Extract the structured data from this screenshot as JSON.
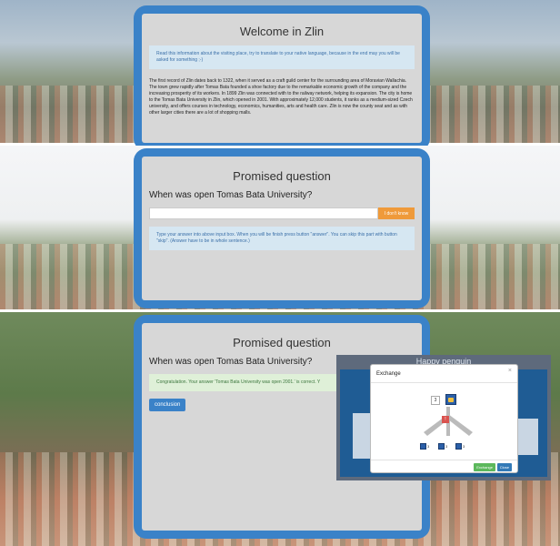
{
  "screen1": {
    "title": "Welcome in Zlin",
    "info": "Read this information about the visiting place, try to translate to your native language, because in the end may you will be asked for something ;-)",
    "body": "The first record of Zlin dates back to 1322, when it served as a craft guild center for the surrounding area of Moravian Wallachia. The town grew rapidly after Tomas Bata founded a shoe factory due to the remarkable economic growth of the company and the increasing prosperity of its workers. In 1899 Zlin was connected with to the railway network, helping its expansion. The city is home to the Tomas Bata University in Zlin, which opened in 2001. With approximately 12,000 students, it ranks as a medium-sized Czech university, and offers courses in technology, economics, humanities, arts and health care. Zlin is now the county seat and as with other larger cities there are a lot of shopping malls."
  },
  "screen2": {
    "title": "Promised question",
    "question": "When was open Tomas Bata University?",
    "dont_know_label": "I don't know",
    "hint": "Type your answer into above input box. When you will be finish press button \"answer\". You can skip this part with button \"skip\". (Answer have to be in whole sentence.)"
  },
  "screen3": {
    "title": "Promised question",
    "question": "When was open Tomas Bata University?",
    "success": "Congratulation. Your answer 'Tomas Bata University was open 2001.' is correct. Y",
    "conclusion_label": "conclusion"
  },
  "game": {
    "title": "Happy penguin"
  },
  "modal": {
    "title": "Exchange",
    "close_symbol": "×",
    "top_count": "3",
    "bottom_counts": [
      "3",
      "3",
      "3"
    ],
    "exchange_label": "Exchange",
    "close_label": "Close"
  }
}
